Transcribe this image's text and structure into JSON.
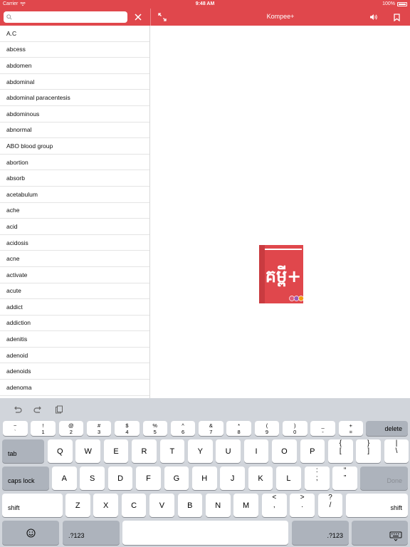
{
  "status_bar": {
    "carrier": "Carrier",
    "time": "9:48 AM",
    "battery": "100%"
  },
  "header": {
    "title": "Kompee+",
    "search_value": "",
    "search_placeholder": ""
  },
  "words": [
    "A.C",
    "abcess",
    "abdomen",
    "abdominal",
    "abdominal paracentesis",
    "abdominous",
    "abnormal",
    "ABO blood group",
    "abortion",
    "absorb",
    "acetabulum",
    "ache",
    "acid",
    "acidosis",
    "acne",
    "activate",
    "acute",
    "addict",
    "addiction",
    "adenitis",
    "adenoid",
    "adenoids",
    "adenoma"
  ],
  "logo": {
    "text": "គម្ពី+",
    "book_color": "#e0474c",
    "dot_colors": [
      "#e05a7a",
      "#9b59b6",
      "#f39c12"
    ]
  },
  "colors": {
    "accent": "#e0474c",
    "keyboard_bg": "#d1d5db"
  },
  "keyboard": {
    "toolbar_icons": [
      "undo-icon",
      "redo-icon",
      "paste-icon"
    ],
    "row1": [
      {
        "top": "~",
        "bot": "`"
      },
      {
        "top": "!",
        "bot": "1"
      },
      {
        "top": "@",
        "bot": "2"
      },
      {
        "top": "#",
        "bot": "3"
      },
      {
        "top": "$",
        "bot": "4"
      },
      {
        "top": "%",
        "bot": "5"
      },
      {
        "top": "^",
        "bot": "6"
      },
      {
        "top": "&",
        "bot": "7"
      },
      {
        "top": "*",
        "bot": "8"
      },
      {
        "top": "(",
        "bot": "9"
      },
      {
        "top": ")",
        "bot": "0"
      },
      {
        "top": "_",
        "bot": "-"
      },
      {
        "top": "+",
        "bot": "="
      }
    ],
    "delete": "delete",
    "tab": "tab",
    "row2": [
      "Q",
      "W",
      "E",
      "R",
      "T",
      "Y",
      "U",
      "I",
      "O",
      "P"
    ],
    "row2_sym": [
      {
        "top": "{",
        "bot": "["
      },
      {
        "top": "}",
        "bot": "]"
      },
      {
        "top": "|",
        "bot": "\\"
      }
    ],
    "caps_lock": "caps lock",
    "row3": [
      "A",
      "S",
      "D",
      "F",
      "G",
      "H",
      "J",
      "K",
      "L"
    ],
    "row3_sym": [
      {
        "top": ":",
        "bot": ";"
      },
      {
        "top": "“",
        "bot": "”"
      }
    ],
    "done": "Done",
    "shift": "shift",
    "row4": [
      "Z",
      "X",
      "C",
      "V",
      "B",
      "N",
      "M"
    ],
    "row4_sym": [
      {
        "top": "<",
        "bot": ","
      },
      {
        "top": ">",
        "bot": "."
      },
      {
        "top": "?",
        "bot": "/"
      }
    ],
    "numbers": ".?123",
    "emoji_icon": "emoji-icon",
    "hide_keyboard_icon": "keyboard-dismiss-icon"
  }
}
